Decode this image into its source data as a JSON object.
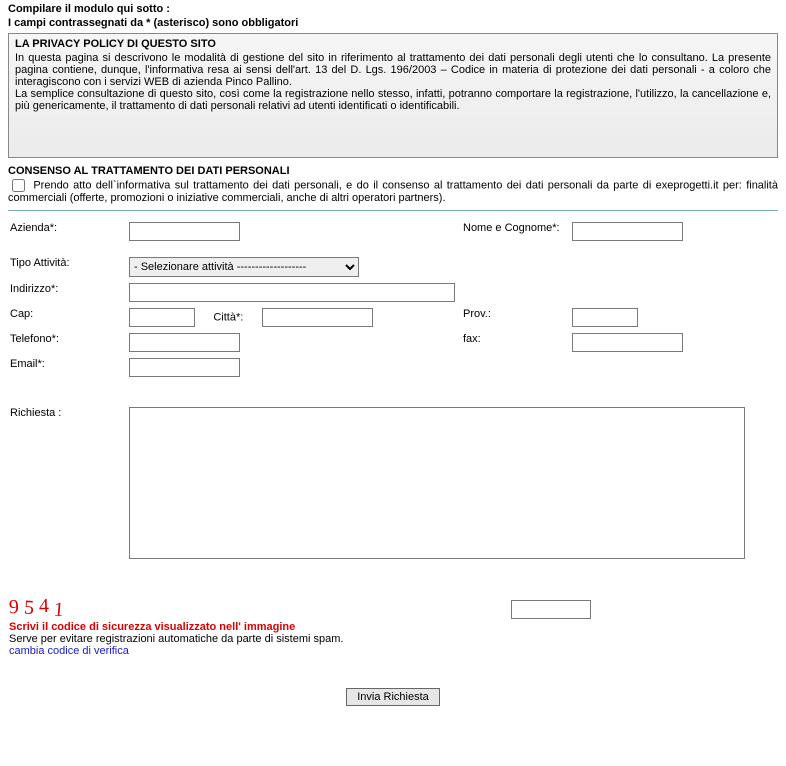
{
  "header": {
    "line1": "Compilare il modulo qui sotto :",
    "line2": "I campi contrassegnati da * (asterisco) sono obbligatori"
  },
  "privacy": {
    "title": "LA PRIVACY POLICY DI QUESTO SITO",
    "body": "  In questa pagina si descrivono le modalità di gestione del sito in riferimento al trattamento dei dati personali degli utenti che lo consultano. La presente pagina contiene, dunque, l'informativa resa ai sensi dell'art. 13 del D. Lgs. 196/2003 – Codice in materia di protezione dei dati personali - a coloro che interagiscono con i servizi WEB di azienda Pinco Pallino.\n  La semplice consultazione di questo sito, così come la registrazione nello stesso, infatti, potranno comportare la registrazione, l'utilizzo, la cancellazione e, più genericamente, il trattamento di dati personali relativi ad utenti identificati o identificabili."
  },
  "consent": {
    "title": "CONSENSO AL TRATTAMENTO DEI DATI PERSONALI",
    "text": "  Prendo atto dell`informativa sul trattamento dei dati personali, e do il consenso al trattamento dei dati personali da parte di exeprogetti.it per: finalità commerciali (offerte, promozioni o iniziative commerciali, anche di altri operatori partners)."
  },
  "labels": {
    "azienda": "Azienda*:",
    "nome": "Nome e Cognome*:",
    "tipo": "Tipo Attività:",
    "indirizzo": "Indirizzo*:",
    "cap": "Cap:",
    "citta": "Città*:",
    "prov": "Prov.:",
    "telefono": "Telefono*:",
    "fax": "fax:",
    "email": "Email*:",
    "richiesta": "Richiesta :"
  },
  "select": {
    "tipo_placeholder": "- Selezionare attività -------------------"
  },
  "captcha": {
    "d1": "9",
    "d2": "5",
    "d3": "4",
    "d4": "1",
    "label": "Scrivi il codice di sicurezza visualizzato nell' immagine",
    "help": "Serve per evitare registrazioni automatiche da parte di sistemi spam.",
    "change": "cambia codice di verifica"
  },
  "submit": {
    "label": "Invia Richiesta"
  }
}
